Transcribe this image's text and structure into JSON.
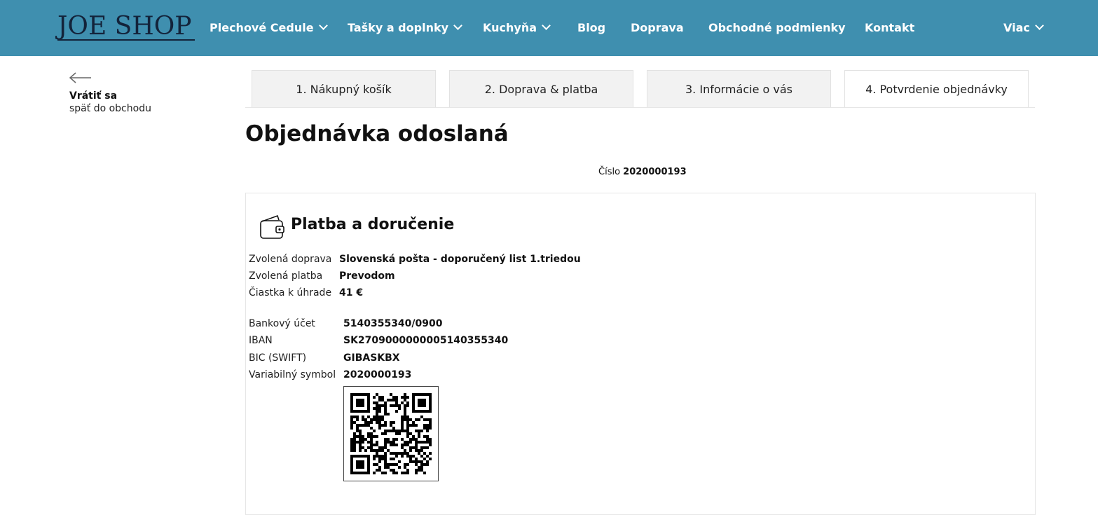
{
  "header": {
    "logo_text": "JOE SHOP",
    "nav": {
      "plechove": "Plechové Cedule",
      "tasky": "Tašky a doplnky",
      "kuchyna": "Kuchyňa",
      "blog": "Blog",
      "doprava": "Doprava",
      "podmienky": "Obchodné podmienky",
      "kontakt": "Kontakt",
      "viac": "Viac"
    },
    "accent_color": "#3f8faf"
  },
  "back": {
    "title": "Vrátiť sa",
    "subtitle": "späť do obchodu"
  },
  "steps": {
    "s1": "1. Nákupný košík",
    "s2": "2. Doprava & platba",
    "s3": "3. Informácie o vás",
    "s4": "4. Potvrdenie objednávky",
    "active": "4. Potvrdenie objednávky"
  },
  "page_title": "Objednávka odoslaná",
  "order": {
    "label": "Číslo",
    "number": "2020000193"
  },
  "payment": {
    "section_title": "Platba a doručenie",
    "shipping_label": "Zvolená doprava",
    "shipping_value": "Slovenská pošta - doporučený list 1.triedou",
    "method_label": "Zvolená platba",
    "method_value": "Prevodom",
    "amount_label": "Čiastka k úhrade",
    "amount_value": "41 €",
    "account_label": "Bankový účet",
    "account_value": "5140355340/0900",
    "iban_label": "IBAN",
    "iban_value": "SK2709000000005140355340",
    "bic_label": "BIC (SWIFT)",
    "bic_value": "GIBASKBX",
    "vs_label": "Variabilný symbol",
    "vs_value": "2020000193"
  },
  "icons": {
    "back": "arrow-left-icon",
    "wallet": "wallet-icon",
    "chevron": "chevron-down-icon"
  }
}
